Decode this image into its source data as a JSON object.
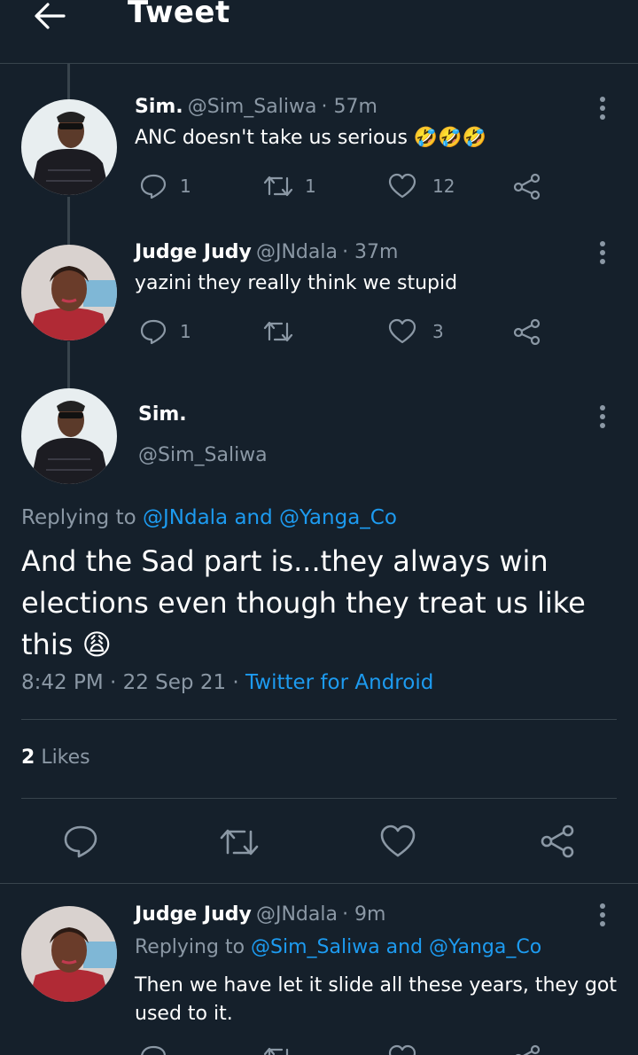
{
  "header": {
    "title": "Tweet"
  },
  "tweets": [
    {
      "name": "Sim.",
      "handle": "@Sim_Saliwa",
      "time": "· 57m",
      "text": "ANC doesn't take us serious",
      "emojis": "🤣🤣🤣",
      "replies": "1",
      "retweets": "1",
      "likes": "12"
    },
    {
      "name": "Judge Judy",
      "handle": "@JNdala",
      "time": "· 37m",
      "text": "yazini they really think we stupid",
      "replies": "1",
      "retweets": "",
      "likes": "3"
    }
  ],
  "main": {
    "name": "Sim.",
    "handle": "@Sim_Saliwa",
    "replying_prefix": "Replying to ",
    "replying_to": "@JNdala and @Yanga_Co",
    "text": "And the Sad part is...they always win elections even though they treat us like this",
    "emoji": "😩",
    "timestamp": "8:42 PM · 22 Sep 21 · ",
    "source": "Twitter for Android",
    "likes_count": "2",
    "likes_label": "Likes"
  },
  "reply": {
    "name": "Judge Judy",
    "handle": "@JNdala",
    "time": "· 9m",
    "replying_prefix": "Replying to ",
    "replying_to": "@Sim_Saliwa and @Yanga_Co",
    "text": "Then we have let it slide all these years,  they got used to it."
  },
  "colors": {
    "background": "#15202b",
    "accent": "#1d9bf0",
    "muted": "#8b98a5",
    "divider": "#38444d"
  }
}
